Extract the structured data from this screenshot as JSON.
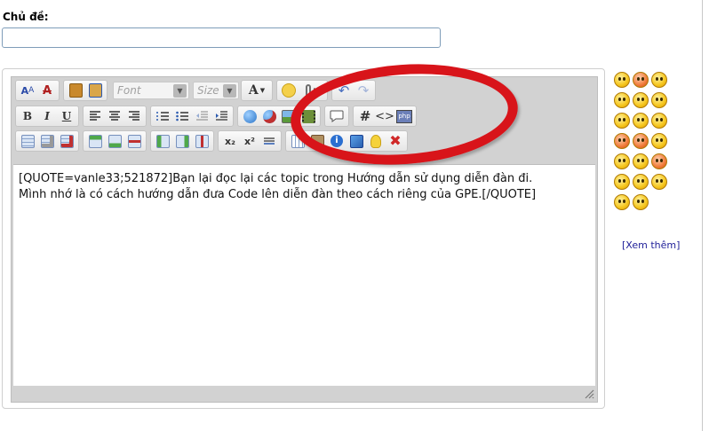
{
  "subject": {
    "label": "Chủ đề:",
    "value": ""
  },
  "toolbar": {
    "font_placeholder": "Font",
    "size_placeholder": "Size",
    "text_color_label": "A",
    "bold_label": "B",
    "italic_label": "I",
    "underline_label": "U",
    "hash_label": "#",
    "code_label": "<>",
    "php_label": "php",
    "subscript_label": "x₂",
    "superscript_label": "x²"
  },
  "editor": {
    "line1": "[QUOTE=vanle33;521872]Bạn lại đọc lại các topic trong Hướng dẫn sử dụng diễn đàn đi.",
    "line2": "Mình nhớ là có cách hướng dẫn đưa Code lên diễn đàn theo cách riêng của GPE.[/QUOTE]"
  },
  "smilies_more": "[Xem thêm]",
  "colors": {
    "highlight_ellipse": "#d8141a",
    "link": "#22229a"
  }
}
